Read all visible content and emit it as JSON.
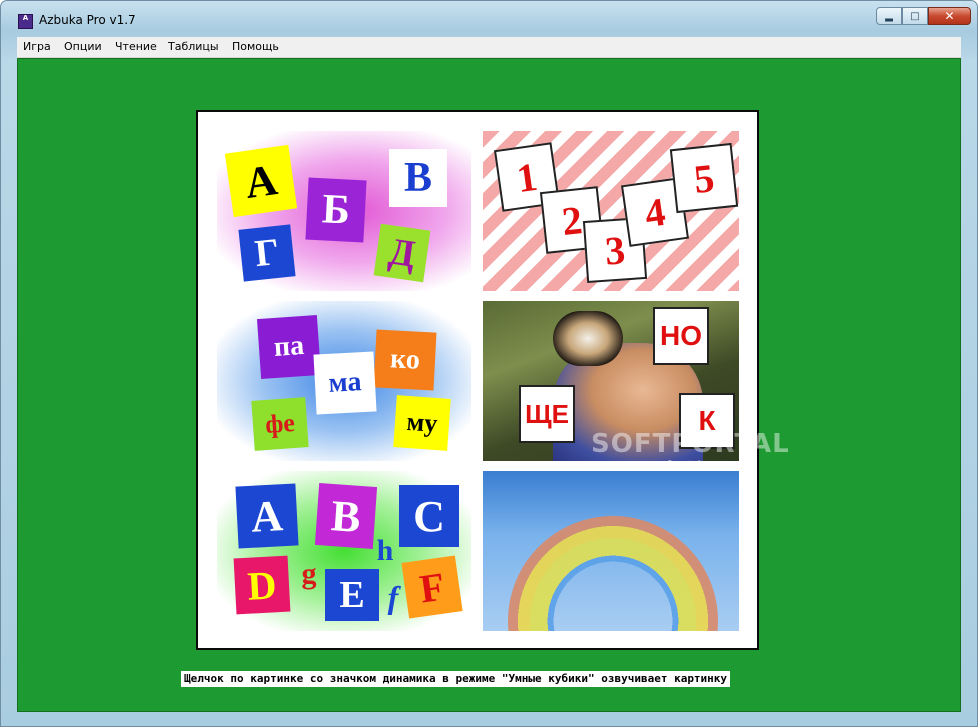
{
  "window": {
    "title": "Azbuka Pro v1.7",
    "icon": "app-icon",
    "icon_letters": "A"
  },
  "menu": {
    "items": [
      "Игра",
      "Опции",
      "Чтение",
      "Таблицы",
      "Помощь"
    ]
  },
  "tiles": {
    "cyrillic_letters": [
      "А",
      "Б",
      "В",
      "Г",
      "Д"
    ],
    "numbers": [
      "1",
      "2",
      "3",
      "4",
      "5"
    ],
    "syllables": [
      "па",
      "ко",
      "ма",
      "фе",
      "му"
    ],
    "photo_syllables": [
      "НО",
      "ЩЕ",
      "К"
    ],
    "latin_letters": [
      "A",
      "B",
      "C",
      "h",
      "D",
      "g",
      "E",
      "f",
      "F"
    ]
  },
  "watermark": {
    "logo": "SOFTPORTAL",
    "url": "www.softportal.com"
  },
  "status": {
    "text": "Щелчок по картинке со значком динамика в режиме \"Умные кубики\" озвучивает картинку"
  }
}
